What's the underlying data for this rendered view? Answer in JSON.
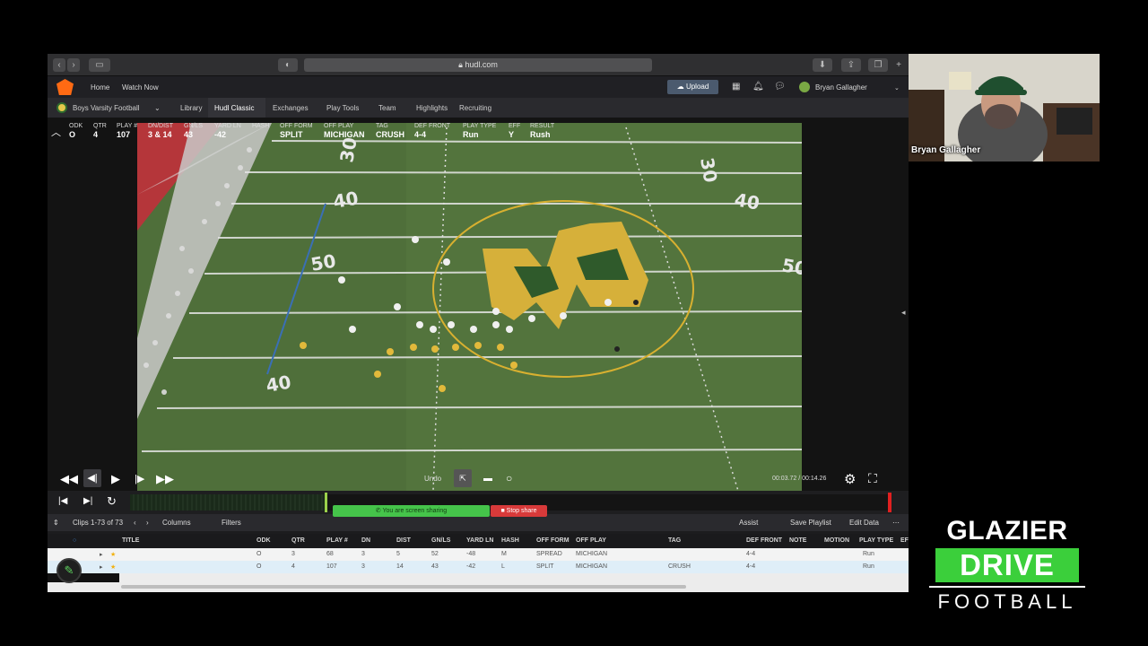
{
  "browser": {
    "url": "hudl.com"
  },
  "topnav": {
    "home": "Home",
    "watch_now": "Watch Now",
    "upload": "Upload",
    "user_name": "Bryan Gallagher"
  },
  "subnav": {
    "team": "Boys Varsity Football",
    "items": [
      "Library",
      "Hudl Classic",
      "Exchanges",
      "Play Tools",
      "Team",
      "Highlights",
      "Recruiting"
    ]
  },
  "play_info": {
    "fields": [
      {
        "head": "ODK",
        "value": "O"
      },
      {
        "head": "QTR",
        "value": "4"
      },
      {
        "head": "PLAY #",
        "value": "107"
      },
      {
        "head": "DN/DIST",
        "value": "3 & 14"
      },
      {
        "head": "GN/LS",
        "value": "43"
      },
      {
        "head": "YARD LN",
        "value": "-42"
      },
      {
        "head": "HASH",
        "value": ""
      },
      {
        "head": "OFF FORM",
        "value": "SPLIT"
      },
      {
        "head": "OFF PLAY",
        "value": "MICHIGAN"
      },
      {
        "head": "TAG",
        "value": "CRUSH"
      },
      {
        "head": "DEF FRONT",
        "value": "4-4"
      },
      {
        "head": "PLAY TYPE",
        "value": "Run"
      },
      {
        "head": "EFF",
        "value": "Y"
      },
      {
        "head": "RESULT",
        "value": "Rush"
      }
    ]
  },
  "video": {
    "undo": "Undo",
    "timecode": "00:03.72 / 00:14.26",
    "yard_numbers": [
      "30",
      "40",
      "50",
      "40",
      "30",
      "40",
      "50"
    ]
  },
  "screen_share": {
    "message": "You are screen sharing",
    "stop": "Stop share"
  },
  "grid_toolbar": {
    "clips": "Clips 1-73 of 73",
    "columns": "Columns",
    "filters": "Filters",
    "assist": "Assist",
    "save_playlist": "Save Playlist",
    "edit_data": "Edit Data"
  },
  "grid": {
    "headers": [
      "TITLE",
      "ODK",
      "QTR",
      "PLAY #",
      "DN",
      "DIST",
      "GN/LS",
      "YARD LN",
      "HASH",
      "OFF FORM",
      "OFF PLAY",
      "TAG",
      "DEF FRONT",
      "NOTE",
      "MOTION",
      "PLAY TYPE",
      "EF"
    ],
    "rows": [
      {
        "odk": "O",
        "qtr": "3",
        "play": "68",
        "dn": "3",
        "dist": "5",
        "gnls": "52",
        "yardln": "-48",
        "hash": "M",
        "offform": "SPREAD",
        "offplay": "MICHIGAN",
        "tag": "",
        "deffront": "4-4",
        "playtype": "Run"
      },
      {
        "odk": "O",
        "qtr": "4",
        "play": "107",
        "dn": "3",
        "dist": "14",
        "gnls": "43",
        "yardln": "-42",
        "hash": "L",
        "offform": "SPLIT",
        "offplay": "MICHIGAN",
        "tag": "CRUSH",
        "deffront": "4-4",
        "playtype": "Run"
      }
    ]
  },
  "webcam": {
    "name": "Bryan Gallagher"
  },
  "brand": {
    "line1": "GLAZIER",
    "line2": "DRIVE",
    "line3": "FOOTBALL"
  }
}
